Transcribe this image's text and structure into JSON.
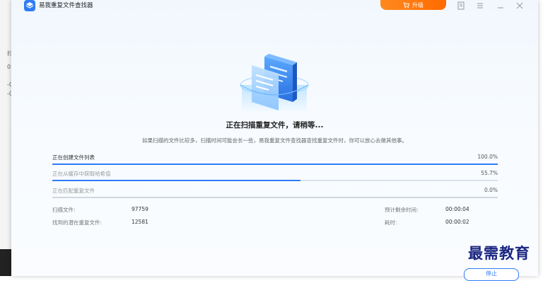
{
  "app": {
    "title": "易我重复文件查找器",
    "upgrade_label": "升级"
  },
  "background_window": {
    "fragments": [
      "扫",
      "0",
      "-0",
      "-0"
    ]
  },
  "scan": {
    "headline": "正在扫描重复文件，请稍等...",
    "subline": "如果扫描的文件比较多，扫描时间可能会长一些，易我重复文件查找器查找重复文件时，你可以放心去做其他事。",
    "steps": [
      {
        "label": "正在创建文件列表",
        "percent_text": "100.0%",
        "progress": 1.0
      },
      {
        "label": "正在从缓存中获取哈希值",
        "percent_text": "55.7%",
        "progress": 0.557
      },
      {
        "label": "正在匹配重复文件",
        "percent_text": "0.0%",
        "progress": 0.0
      }
    ]
  },
  "stats": {
    "scanned_label": "扫描文件:",
    "scanned_value": "97759",
    "found_label": "找到的潜在重复文件:",
    "found_value": "12581",
    "remaining_label": "预计剩余时间:",
    "remaining_value": "00:00:04",
    "elapsed_label": "耗时:",
    "elapsed_value": "00:00:02"
  },
  "watermark": "最需教育",
  "stop_label": "停止",
  "colors": {
    "accent": "#2f7cf6",
    "upgrade": "#ff7a00",
    "watermark": "#1b2580"
  }
}
